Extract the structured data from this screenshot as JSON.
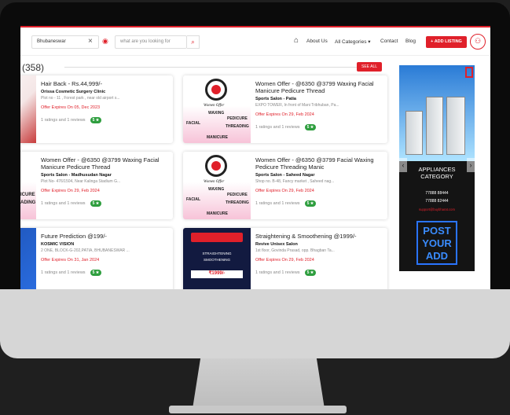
{
  "header": {
    "location_value": "Bhubaneswar",
    "search_placeholder": "what are you looking for",
    "nav_about": "About Us",
    "nav_categories": "All Categories",
    "nav_contact": "Contact",
    "nav_blog": "Blog",
    "add_listing": "+ ADD LISTING"
  },
  "listing": {
    "count": "(358)",
    "see_all": "SEE ALL"
  },
  "cards": [
    {
      "title": "Hair Back - Rs.44,999/-",
      "business": "Orissa Cosmetic Surgery Clinic",
      "address": "Plot no - 11 , Forest park , near old airport s...",
      "expires": "Offer Expires On 05, Dec 2023",
      "ratings": "1 ratings and 1 reviews",
      "score": "5"
    },
    {
      "title": "Women Offer - @6350 @3799 Waxing Facial Manicure Pedicure Thread",
      "business": "Sports Salon - Patia",
      "address": "EXPO TOWER, In front of Mani Tribhuban, Pa...",
      "expires": "Offer Expires On 29, Feb 2024",
      "ratings": "1 ratings and 1 reviews",
      "score": "5"
    },
    {
      "title": "Women Offer - @6350 @3799 Waxing Facial Manicure Pedicure Thread",
      "business": "Sports Salon - Madhusudan Nagar",
      "address": "Plot No- 476/1504, Near Kalinga Stadium G...",
      "expires": "Offer Expires On 29, Feb 2024",
      "ratings": "1 ratings and 1 reviews",
      "score": "5"
    },
    {
      "title": "Women Offer - @6350 @3799 Facial Waxing Pedicure Threading Manic",
      "business": "Sports Salon - Saheed Nagar",
      "address": "Shop no. B-48, Fancy market , Saheed nag...",
      "expires": "Offer Expires On 29, Feb 2024",
      "ratings": "1 ratings and 1 reviews",
      "score": "5"
    },
    {
      "title": "Future Prediction @199/-",
      "business": "KOSMIC VISION",
      "address": "2 ONE, BLOCK-G-202,PATIA, BHUBANESWAR ...",
      "expires": "Offer Expires On 31, Jan 2024",
      "ratings": "1 ratings and 1 reviews",
      "score": "5"
    },
    {
      "title": "Straightening & Smoothening @1999/-",
      "business": "Revive Unisex Salon",
      "address": "1st floor, Govinda Prasad, opp. Bhagban Ta...",
      "expires": "Offer Expires On 29, Feb 2024",
      "ratings": "1 ratings and 1 reviews",
      "score": "5"
    }
  ],
  "offer_image": {
    "line1": "Women Offer",
    "waxing": "WAXING",
    "pedicure": "PEDICURE",
    "facial": "FACIAL",
    "threading": "THREADING",
    "manicure": "MANICURE"
  },
  "salon_image": {
    "line1": "STRAIGHTENING",
    "line2": "SMOOTHENING",
    "price": "₹1999/-"
  },
  "ad": {
    "category_line1": "APPLIANCES",
    "category_line2": "CATEGORY",
    "phone1": "77888 88444",
    "phone2": "77888 82444",
    "email": "support@buybharat.com",
    "post": "POST",
    "your": "YOUR",
    "add": "ADD"
  },
  "colors": {
    "accent": "#e0202a",
    "rating": "#2e9e3e"
  },
  "icons": [
    "home-icon",
    "close-icon",
    "map-pin-icon",
    "search-icon",
    "user-icon",
    "star-icon",
    "bookmark-icon",
    "chevron-left-icon",
    "chevron-right-icon"
  ]
}
